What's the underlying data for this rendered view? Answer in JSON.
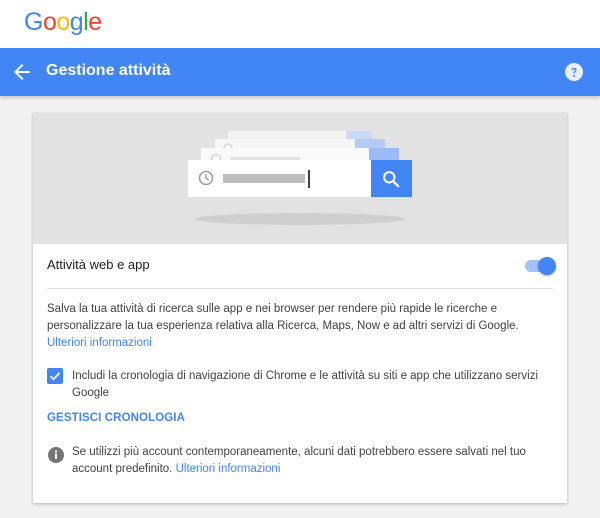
{
  "header": {
    "logo_letters": [
      {
        "char": "G",
        "color": "#4285f4"
      },
      {
        "char": "o",
        "color": "#ea4335"
      },
      {
        "char": "o",
        "color": "#fbbc05"
      },
      {
        "char": "g",
        "color": "#4285f4"
      },
      {
        "char": "l",
        "color": "#34a853"
      },
      {
        "char": "e",
        "color": "#ea4335"
      }
    ]
  },
  "appbar": {
    "title": "Gestione attività",
    "back_icon": "arrow-left-icon",
    "help_icon": "help-icon",
    "color": "#4285f4"
  },
  "hero": {
    "illustration": "search-history-illustration",
    "search_icon": "search-icon",
    "history_icon": "clock-icon"
  },
  "setting": {
    "title": "Attività web e app",
    "toggle_on": true,
    "description": "Salva la tua attività di ricerca sulle app e nei browser per rendere più rapide le ricerche e personalizzare la tua esperienza relativa alla Ricerca, Maps, Now e ad altri servizi di Google.",
    "description_link": "Ulteriori informazioni",
    "checkbox_checked": true,
    "checkbox_label": "Includi la cronologia di navigazione di Chrome e le attività su siti e app che utilizzano servizi Google",
    "manage_label": "GESTISCI CRONOLOGIA",
    "info_text": "Se utilizzi più account contemporaneamente, alcuni dati potrebbero essere salvati nel tuo account predefinito.",
    "info_link": "Ulteriori informazioni",
    "info_icon": "info-icon"
  },
  "colors": {
    "accent": "#4285f4",
    "hero_bg": "#e2e2e2",
    "page_bg": "#f1f1f1"
  }
}
